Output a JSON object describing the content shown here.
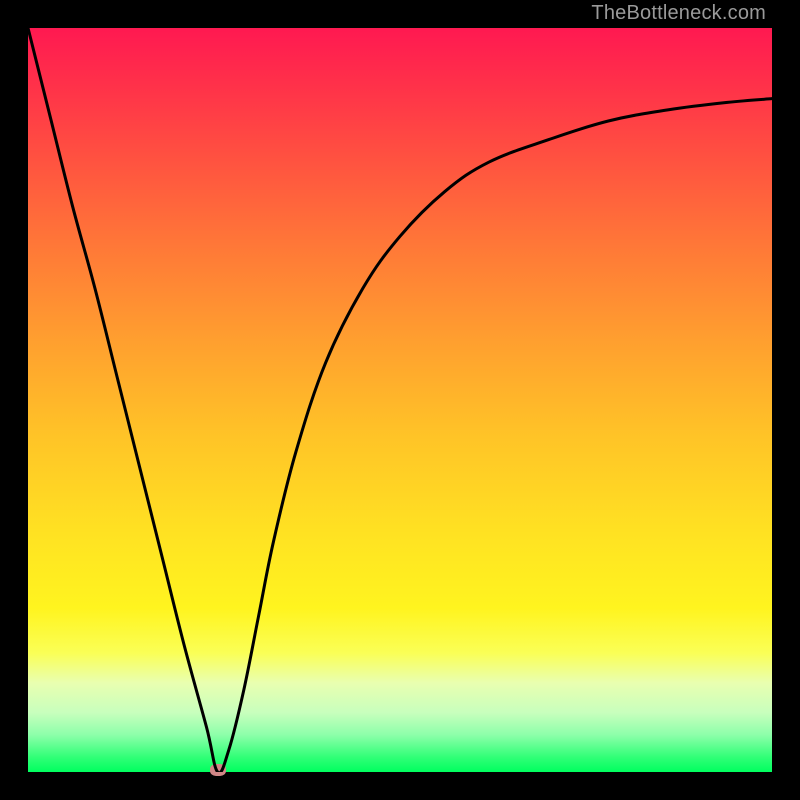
{
  "watermark": "TheBottleneck.com",
  "chart_data": {
    "type": "line",
    "title": "",
    "xlabel": "",
    "ylabel": "",
    "xlim": [
      0,
      100
    ],
    "ylim": [
      0,
      100
    ],
    "series": [
      {
        "name": "curve",
        "x": [
          0,
          3,
          6,
          9,
          12,
          15,
          18,
          21,
          24,
          25.5,
          27,
          29,
          31,
          33,
          36,
          40,
          45,
          50,
          56,
          62,
          70,
          78,
          86,
          94,
          100
        ],
        "y": [
          100,
          88,
          76,
          65,
          53,
          41,
          29,
          17,
          6,
          0,
          3,
          11,
          21,
          31,
          43,
          55,
          65,
          72,
          78,
          82,
          85,
          87.5,
          89,
          90,
          90.5
        ]
      }
    ],
    "marker": {
      "x": 25.5,
      "y": 0
    },
    "colors": {
      "curve": "#000000",
      "marker": "#d18686",
      "gradient_top": "#ff1951",
      "gradient_bottom": "#00ff5f"
    }
  }
}
